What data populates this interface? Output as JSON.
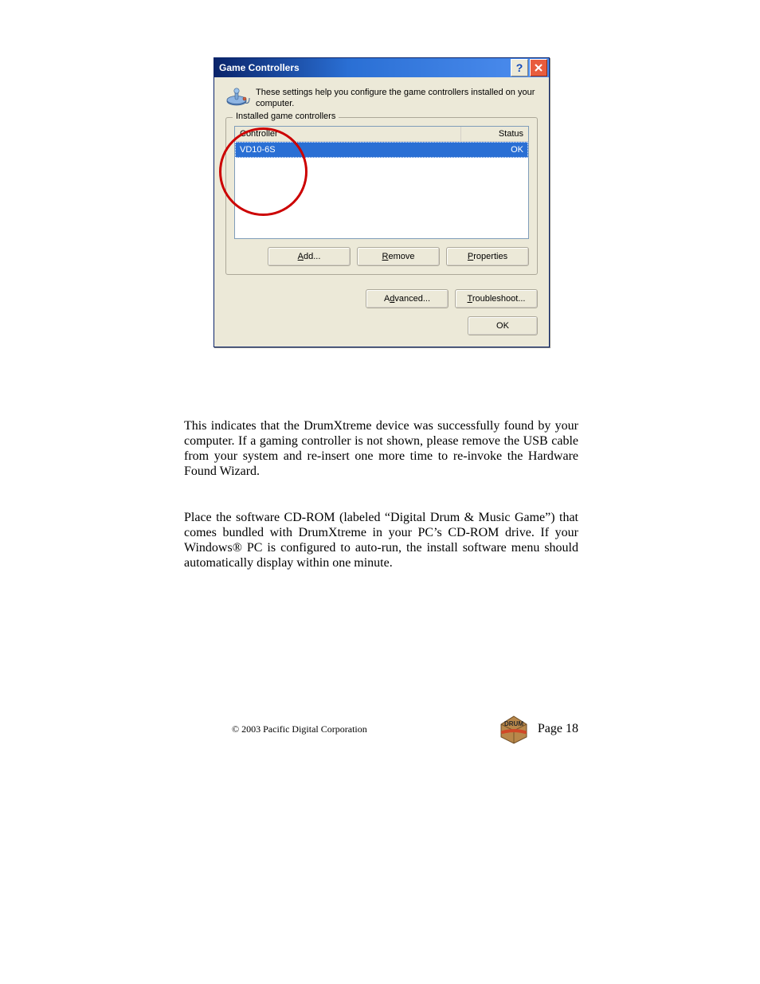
{
  "dialog": {
    "title": "Game Controllers",
    "description": "These settings help you configure the game controllers installed on your computer.",
    "group_legend": "Installed game controllers",
    "columns": {
      "controller": "Controller",
      "status": "Status"
    },
    "rows": [
      {
        "controller": "VD10-6S",
        "status": "OK"
      }
    ],
    "buttons": {
      "add": "Add...",
      "remove": "Remove",
      "properties": "Properties",
      "advanced": "Advanced...",
      "troubleshoot": "Troubleshoot...",
      "ok": "OK"
    }
  },
  "paragraphs": {
    "p1": "This indicates that the DrumXtreme device was successfully found by your computer.   If a gaming controller is not shown, please remove the USB cable from your system and re-insert one more time to re-invoke the Hardware Found Wizard.",
    "p2": "Place the software CD-ROM (labeled “Digital Drum & Music Game”) that comes bundled with DrumXtreme in your PC’s CD-ROM drive.  If your Windows® PC is configured to auto-run, the install software menu should automatically display within one minute."
  },
  "footer": {
    "copyright": "© 2003 Pacific Digital Corporation",
    "page": "Page 18",
    "logo_text": "DRUM"
  }
}
